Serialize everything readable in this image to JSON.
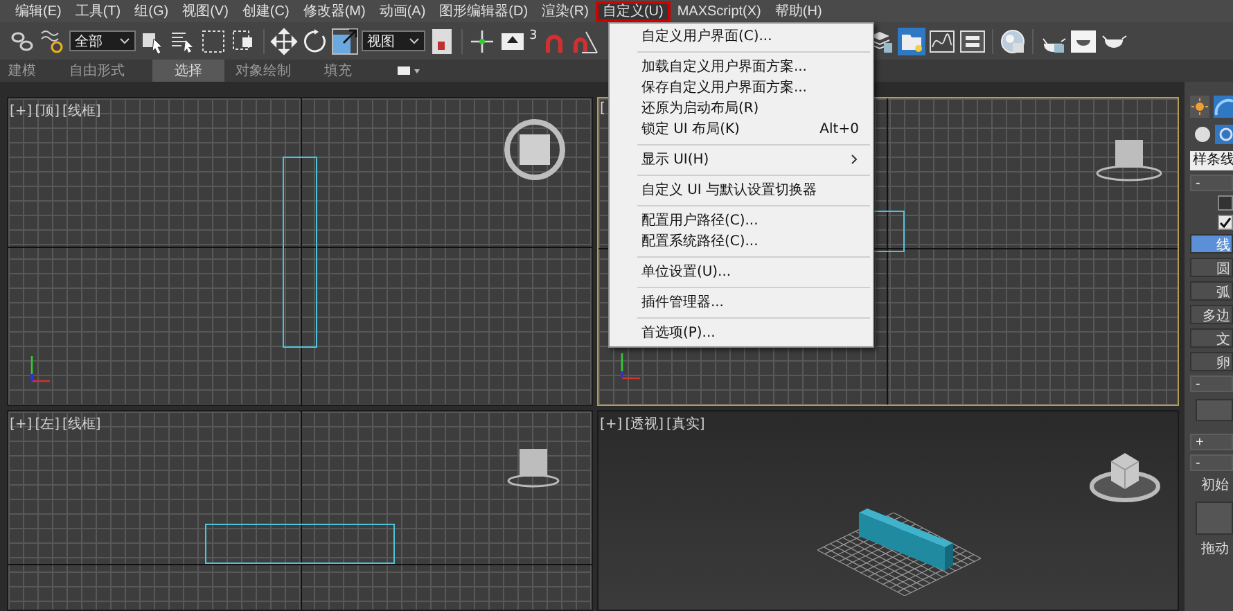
{
  "menu_bar": {
    "items": [
      {
        "label": "编辑(E)",
        "selected": false
      },
      {
        "label": "工具(T)",
        "selected": false
      },
      {
        "label": "组(G)",
        "selected": false
      },
      {
        "label": "视图(V)",
        "selected": false
      },
      {
        "label": "创建(C)",
        "selected": false
      },
      {
        "label": "修改器(M)",
        "selected": false
      },
      {
        "label": "动画(A)",
        "selected": false
      },
      {
        "label": "图形编辑器(D)",
        "selected": false
      },
      {
        "label": "渲染(R)",
        "selected": false
      },
      {
        "label": "自定义(U)",
        "selected": true
      },
      {
        "label": "MAXScript(X)",
        "selected": false
      },
      {
        "label": "帮助(H)",
        "selected": false
      }
    ]
  },
  "toolbar": {
    "selection_filter": "全部",
    "reference_coordinate": "视图",
    "snap_label": "3"
  },
  "ribbon": {
    "tabs": [
      {
        "label": "建模",
        "selected": false
      },
      {
        "label": "自由形式",
        "selected": false
      },
      {
        "label": "选择",
        "selected": true
      },
      {
        "label": "对象绘制",
        "selected": false
      },
      {
        "label": "填充",
        "selected": false
      }
    ]
  },
  "viewports": [
    {
      "kind": "top",
      "active": false,
      "labels": [
        "[+]",
        "[顶]",
        "[线框]"
      ]
    },
    {
      "kind": "front",
      "active": true,
      "labels": [
        "["
      ]
    },
    {
      "kind": "left",
      "active": false,
      "labels": [
        "[+]",
        "[左]",
        "[线框]"
      ]
    },
    {
      "kind": "perspective",
      "active": false,
      "labels": [
        "[+]",
        "[透视]",
        "[真实]"
      ]
    }
  ],
  "dropdown_menu": {
    "groups": [
      [
        {
          "label": "自定义用户界面(C)...",
          "submenu": false
        }
      ],
      [
        {
          "label": "加载自定义用户界面方案...",
          "submenu": false
        },
        {
          "label": "保存自定义用户界面方案...",
          "submenu": false
        },
        {
          "label": "还原为启动布局(R)",
          "submenu": false
        },
        {
          "label": "锁定 UI 布局(K)",
          "shortcut": "Alt+0",
          "submenu": false
        }
      ],
      [
        {
          "label": "显示 UI(H)",
          "submenu": true
        }
      ],
      [
        {
          "label": "自定义 UI 与默认设置切换器",
          "submenu": false
        }
      ],
      [
        {
          "label": "配置用户路径(C)...",
          "submenu": false
        },
        {
          "label": "配置系统路径(C)...",
          "submenu": false
        }
      ],
      [
        {
          "label": "单位设置(U)...",
          "submenu": false
        }
      ],
      [
        {
          "label": "插件管理器...",
          "submenu": false
        }
      ],
      [
        {
          "label": "首选项(P)...",
          "submenu": false
        }
      ]
    ]
  },
  "command_panel": {
    "object_type": "样条线",
    "rollout_toggles": [
      "-",
      "-",
      "+",
      "-"
    ],
    "checkboxes": [
      {
        "checked": false
      },
      {
        "checked": true
      }
    ],
    "object_buttons": [
      {
        "label": "线",
        "selected": true
      },
      {
        "label": "圆",
        "selected": false
      },
      {
        "label": "弧",
        "selected": false
      },
      {
        "label": "多边",
        "selected": false
      },
      {
        "label": "文",
        "selected": false
      },
      {
        "label": "卵",
        "selected": false
      }
    ],
    "group_labels": [
      "初始",
      "拖动"
    ]
  }
}
